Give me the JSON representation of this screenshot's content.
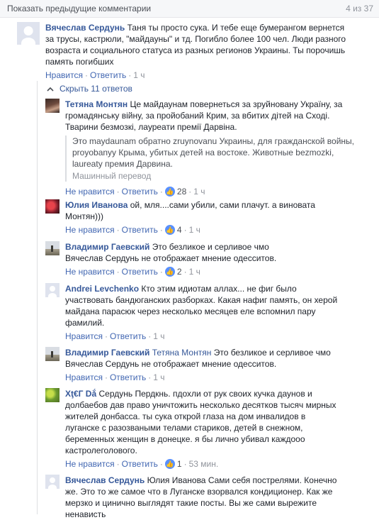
{
  "header": {
    "show_previous": "Показать предыдущие комментарии",
    "count": "4 из 37"
  },
  "replies_toggle": "Скрыть 11 ответов",
  "comments": [
    {
      "author": "Вячеслав Сердунь",
      "text": "Таня ты просто сука. И тебе еще бумерангом вернется за трусы, кастрюли, \"майдауны\" и тд. Погибло более 100 чел. Люди разного возраста и социального статуса из разных регионов Украины. Ты порочишь память погибших",
      "like": "Нравится",
      "reply": "Ответить",
      "time": "1 ч"
    },
    {
      "author": "Тетяна Монтян",
      "text": "Це майдаунам повернеться за зруйновану Україну, за громадянську війну, за пройобаний Крим, за вбитих дітей на Сході. Тварини безмозкі, лауреати премії Дарвіна.",
      "translation": "Это maydaunam обратно zruynovanu Украины, для гражданской войны, proyobanyy Крыма, убитых детей на востоке. Животные bezmozki, laureaty премия Дарвина.",
      "translation_note": "Машинный перевод",
      "like": "Не нравится",
      "reply": "Ответить",
      "reactions": "28",
      "time": "1 ч"
    },
    {
      "author": "Юлия Иванова",
      "text": "ой, мля....сами убили, сами плачут. а виновата Монтян)))",
      "like": "Не нравится",
      "reply": "Ответить",
      "reactions": "4",
      "time": "1 ч"
    },
    {
      "author": "Владимир Гаевский",
      "text": "Это безликое и серливое чмо Вячеслав Сердунь не отображает мнение одесситов.",
      "like": "Не нравится",
      "reply": "Ответить",
      "reactions": "2",
      "time": "1 ч"
    },
    {
      "author": "Andrei Levchenko",
      "text": "Кто этим идиотам аллах... не фиг было участвовать бандюганских разборках. Какая нафиг память, он херой майдана парасюк через несколько месяцев еле вспомнил пару фамилий.",
      "like": "Нравится",
      "reply": "Ответить",
      "time": "1 ч"
    },
    {
      "author": "Владимир Гаевский",
      "mention": "Тетяна Монтян",
      "text": "Это безликое и серливое чмо Вячеслав Сердунь не отображает мнение одесситов.",
      "like": "Нравится",
      "reply": "Ответить",
      "time": "1 ч"
    },
    {
      "author": "Xţ€Г Dắ",
      "text": "Сердунь Пердкнь. пдохли от рук своих кучка даунов и долбаебов дав право уничтожить несколько десятков тысяч мирных жителей донбасса. ты сука открой глаза на дом инвалидов в луганске с разозваными телами стариков, детей в снежном, беременных женщин в донецке. я бы лично убивал каждооо кастролеголового.",
      "like": "Не нравится",
      "reply": "Ответить",
      "reactions": "1",
      "time": "53 мин."
    },
    {
      "author": "Вячеслав Сердунь",
      "text": "Юлия Иванова Сами себя пострелями. Конечно же. Это то же самое что в Луганске взорвался кондиционер. Как же мерзко и цинично выглядят такие посты. Вы же сами вырежите ненависть"
    }
  ],
  "colors": {
    "link": "#365899",
    "meta": "#90949c",
    "like_badge": "#5890ff"
  }
}
